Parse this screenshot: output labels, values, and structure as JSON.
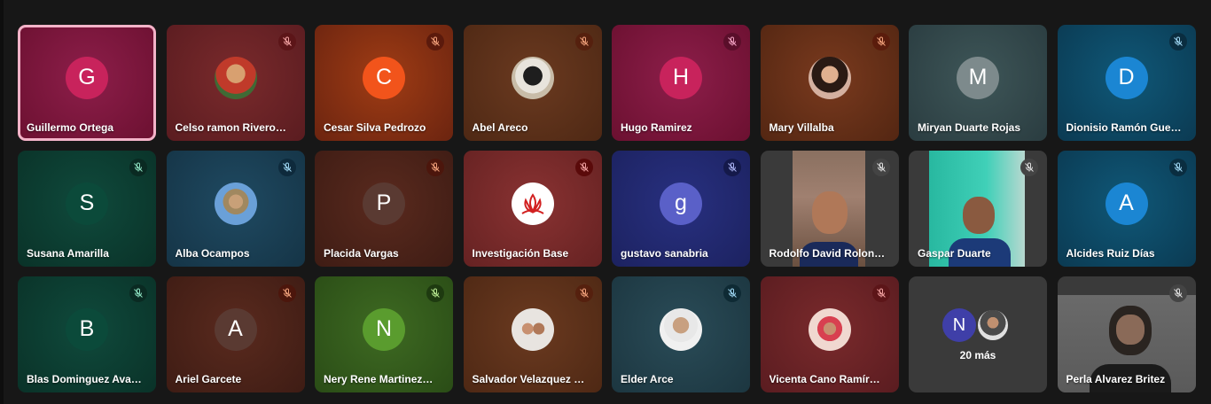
{
  "participants": [
    {
      "name": "Guillermo Ortega",
      "initial": "G"
    },
    {
      "name": "Celso ramon Rivero…",
      "initial": ""
    },
    {
      "name": "Cesar Silva Pedrozo",
      "initial": "C"
    },
    {
      "name": "Abel Areco",
      "initial": ""
    },
    {
      "name": "Hugo Ramirez",
      "initial": "H"
    },
    {
      "name": "Mary Villalba",
      "initial": ""
    },
    {
      "name": "Miryan Duarte Rojas",
      "initial": "M"
    },
    {
      "name": "Dionisio Ramón Gue…",
      "initial": "D"
    },
    {
      "name": "Susana Amarilla",
      "initial": "S"
    },
    {
      "name": "Alba Ocampos",
      "initial": ""
    },
    {
      "name": "Placida Vargas",
      "initial": "P"
    },
    {
      "name": "Investigación Base",
      "initial": ""
    },
    {
      "name": "gustavo sanabria",
      "initial": "g"
    },
    {
      "name": "Rodolfo David Rolon…",
      "initial": ""
    },
    {
      "name": "Gaspar Duarte",
      "initial": ""
    },
    {
      "name": "Alcides Ruiz Días",
      "initial": "A"
    },
    {
      "name": "Blas Dominguez Ava…",
      "initial": "B"
    },
    {
      "name": "Ariel Garcete",
      "initial": "A"
    },
    {
      "name": "Nery Rene Martinez…",
      "initial": "N"
    },
    {
      "name": "Salvador Velazquez …",
      "initial": ""
    },
    {
      "name": "Elder Arce",
      "initial": ""
    },
    {
      "name": "Vicenta Cano Ramír…",
      "initial": ""
    },
    {
      "name": "",
      "initial": ""
    },
    {
      "name": "Perla Alvarez Britez",
      "initial": ""
    }
  ],
  "more_tile": {
    "initial": "N",
    "label": "20 más"
  },
  "colors": {
    "active_border": "#f3b3c8",
    "background": "#171717"
  }
}
